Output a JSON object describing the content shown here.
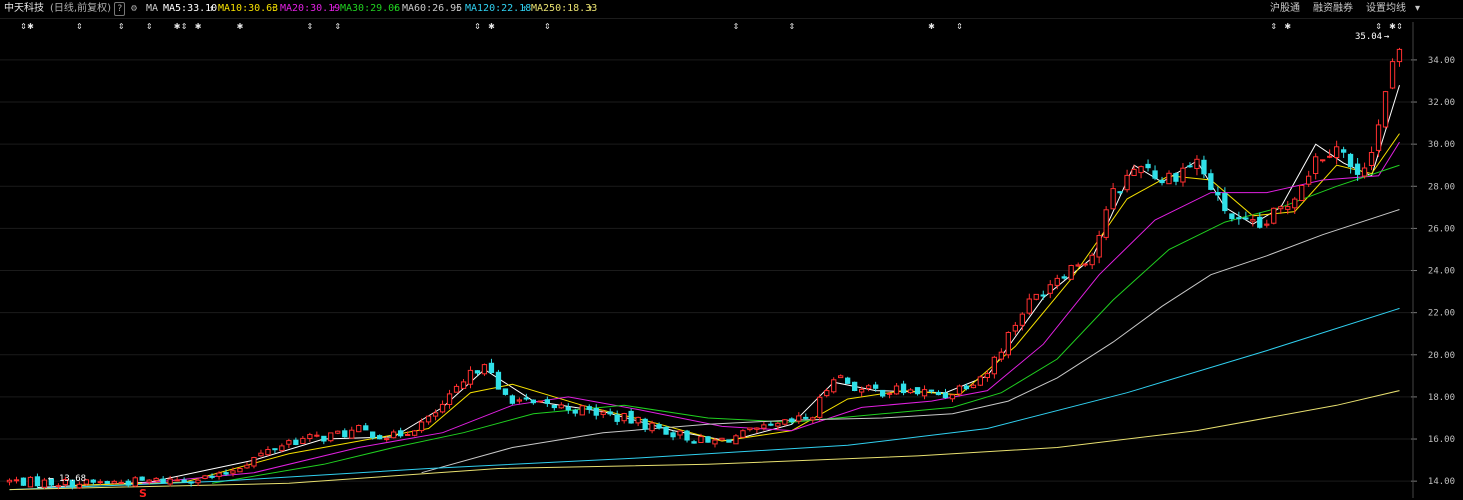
{
  "header": {
    "stock_name": "中天科技",
    "period_info": "(日线,前复权)",
    "help_icon": "?",
    "settings_icon": "gear-icon",
    "ma_label": "MA",
    "ma_values": [
      {
        "label": "MA5:33.10",
        "color": "#ffffff"
      },
      {
        "label": "MA10:30.63",
        "color": "#f5e000"
      },
      {
        "label": "MA20:30.19",
        "color": "#e020e0"
      },
      {
        "label": "MA30:29.06",
        "color": "#20d020"
      },
      {
        "label": "MA60:26.95",
        "color": "#c8c8c8"
      },
      {
        "label": "MA120:22.18",
        "color": "#30d0f0"
      },
      {
        "label": "MA250:18.33",
        "color": "#e8e070"
      }
    ],
    "up_arrow": "↑",
    "right_buttons": [
      "沪股通",
      "融资融券",
      "设置均线"
    ],
    "dropdown_icon": "▾"
  },
  "colors": {
    "up": "#ff3030",
    "down": "#30e0e8",
    "grid": "#1a1a1a",
    "axis_text": "#c0c0c0"
  },
  "chart_data": {
    "type": "candlestick",
    "ylim": [
      13.2,
      35.8
    ],
    "yticks": [
      "14.00",
      "16.00",
      "18.00",
      "20.00",
      "22.00",
      "24.00",
      "26.00",
      "28.00",
      "30.00",
      "32.00",
      "34.00"
    ],
    "num_bars": 200,
    "max_label": "35.04",
    "min_label": "13.68",
    "marker_text": "S",
    "key_closes": [
      [
        0,
        14.0
      ],
      [
        10,
        13.9
      ],
      [
        20,
        14.0
      ],
      [
        30,
        14.2
      ],
      [
        35,
        15.1
      ],
      [
        40,
        15.9
      ],
      [
        45,
        16.1
      ],
      [
        50,
        16.4
      ],
      [
        55,
        16.1
      ],
      [
        60,
        16.9
      ],
      [
        65,
        18.6
      ],
      [
        68,
        19.8
      ],
      [
        70,
        18.2
      ],
      [
        75,
        17.6
      ],
      [
        80,
        17.5
      ],
      [
        85,
        17.2
      ],
      [
        90,
        16.8
      ],
      [
        95,
        16.3
      ],
      [
        100,
        15.8
      ],
      [
        105,
        16.2
      ],
      [
        110,
        16.6
      ],
      [
        115,
        17.1
      ],
      [
        118,
        19.1
      ],
      [
        122,
        18.3
      ],
      [
        128,
        18.3
      ],
      [
        134,
        18.1
      ],
      [
        140,
        19.2
      ],
      [
        145,
        22.1
      ],
      [
        150,
        23.8
      ],
      [
        155,
        24.8
      ],
      [
        158,
        27.6
      ],
      [
        162,
        29.2
      ],
      [
        165,
        28.3
      ],
      [
        170,
        29.2
      ],
      [
        173,
        27.3
      ],
      [
        176,
        26.2
      ],
      [
        179,
        26.0
      ],
      [
        183,
        27.2
      ],
      [
        187,
        29.3
      ],
      [
        190,
        30.1
      ],
      [
        193,
        28.3
      ],
      [
        196,
        30.9
      ],
      [
        198,
        33.7
      ],
      [
        199,
        34.1
      ]
    ],
    "ma_series": [
      {
        "name": "MA5",
        "color": "#ffffff",
        "points": [
          [
            4,
            13.7
          ],
          [
            20,
            13.95
          ],
          [
            35,
            15.0
          ],
          [
            45,
            16.0
          ],
          [
            55,
            16.1
          ],
          [
            62,
            17.5
          ],
          [
            68,
            19.3
          ],
          [
            75,
            17.8
          ],
          [
            85,
            17.3
          ],
          [
            95,
            16.4
          ],
          [
            103,
            15.9
          ],
          [
            112,
            16.7
          ],
          [
            118,
            18.7
          ],
          [
            124,
            18.3
          ],
          [
            134,
            18.2
          ],
          [
            140,
            19.0
          ],
          [
            148,
            22.7
          ],
          [
            155,
            24.6
          ],
          [
            161,
            29.0
          ],
          [
            165,
            28.2
          ],
          [
            170,
            29.2
          ],
          [
            174,
            27.0
          ],
          [
            178,
            26.2
          ],
          [
            182,
            27.0
          ],
          [
            187,
            30.0
          ],
          [
            191,
            29.1
          ],
          [
            195,
            28.5
          ],
          [
            199,
            32.8
          ]
        ]
      },
      {
        "name": "MA10",
        "color": "#f5e000",
        "points": [
          [
            9,
            13.8
          ],
          [
            25,
            13.95
          ],
          [
            40,
            15.3
          ],
          [
            50,
            15.9
          ],
          [
            60,
            16.5
          ],
          [
            66,
            18.2
          ],
          [
            72,
            18.6
          ],
          [
            82,
            17.6
          ],
          [
            92,
            16.8
          ],
          [
            102,
            15.9
          ],
          [
            112,
            16.4
          ],
          [
            120,
            17.9
          ],
          [
            128,
            18.3
          ],
          [
            136,
            18.1
          ],
          [
            144,
            20.4
          ],
          [
            152,
            23.6
          ],
          [
            160,
            27.4
          ],
          [
            166,
            28.5
          ],
          [
            172,
            28.3
          ],
          [
            178,
            26.6
          ],
          [
            184,
            26.8
          ],
          [
            190,
            29.0
          ],
          [
            195,
            28.6
          ],
          [
            199,
            30.5
          ]
        ]
      },
      {
        "name": "MA20",
        "color": "#e020e0",
        "points": [
          [
            19,
            13.9
          ],
          [
            35,
            14.4
          ],
          [
            50,
            15.6
          ],
          [
            62,
            16.3
          ],
          [
            72,
            17.6
          ],
          [
            80,
            18.0
          ],
          [
            90,
            17.4
          ],
          [
            102,
            16.6
          ],
          [
            112,
            16.4
          ],
          [
            122,
            17.5
          ],
          [
            132,
            17.8
          ],
          [
            140,
            18.3
          ],
          [
            148,
            20.5
          ],
          [
            156,
            23.8
          ],
          [
            164,
            26.4
          ],
          [
            172,
            27.7
          ],
          [
            180,
            27.7
          ],
          [
            188,
            28.3
          ],
          [
            196,
            28.5
          ],
          [
            199,
            30.1
          ]
        ]
      },
      {
        "name": "MA30",
        "color": "#20d020",
        "points": [
          [
            29,
            13.9
          ],
          [
            45,
            14.8
          ],
          [
            55,
            15.6
          ],
          [
            65,
            16.3
          ],
          [
            75,
            17.2
          ],
          [
            88,
            17.6
          ],
          [
            100,
            17.0
          ],
          [
            112,
            16.8
          ],
          [
            125,
            17.2
          ],
          [
            135,
            17.5
          ],
          [
            142,
            18.2
          ],
          [
            150,
            19.8
          ],
          [
            158,
            22.6
          ],
          [
            166,
            25.0
          ],
          [
            174,
            26.3
          ],
          [
            182,
            27.0
          ],
          [
            190,
            28.0
          ],
          [
            199,
            29.0
          ]
        ]
      },
      {
        "name": "MA60",
        "color": "#c8c8c8",
        "points": [
          [
            59,
            14.4
          ],
          [
            72,
            15.6
          ],
          [
            85,
            16.3
          ],
          [
            100,
            16.7
          ],
          [
            112,
            16.9
          ],
          [
            125,
            17.0
          ],
          [
            135,
            17.2
          ],
          [
            143,
            17.8
          ],
          [
            150,
            18.9
          ],
          [
            158,
            20.6
          ],
          [
            165,
            22.3
          ],
          [
            172,
            23.8
          ],
          [
            180,
            24.7
          ],
          [
            188,
            25.7
          ],
          [
            199,
            26.9
          ]
        ]
      },
      {
        "name": "MA120",
        "color": "#30d0f0",
        "points": [
          [
            0,
            13.6
          ],
          [
            30,
            14.0
          ],
          [
            60,
            14.6
          ],
          [
            90,
            15.1
          ],
          [
            120,
            15.7
          ],
          [
            140,
            16.5
          ],
          [
            160,
            18.2
          ],
          [
            180,
            20.2
          ],
          [
            199,
            22.2
          ]
        ]
      },
      {
        "name": "MA250",
        "color": "#e8e070",
        "points": [
          [
            0,
            13.6
          ],
          [
            40,
            13.9
          ],
          [
            70,
            14.6
          ],
          [
            100,
            14.8
          ],
          [
            130,
            15.2
          ],
          [
            150,
            15.6
          ],
          [
            170,
            16.4
          ],
          [
            190,
            17.6
          ],
          [
            199,
            18.3
          ]
        ]
      }
    ]
  }
}
